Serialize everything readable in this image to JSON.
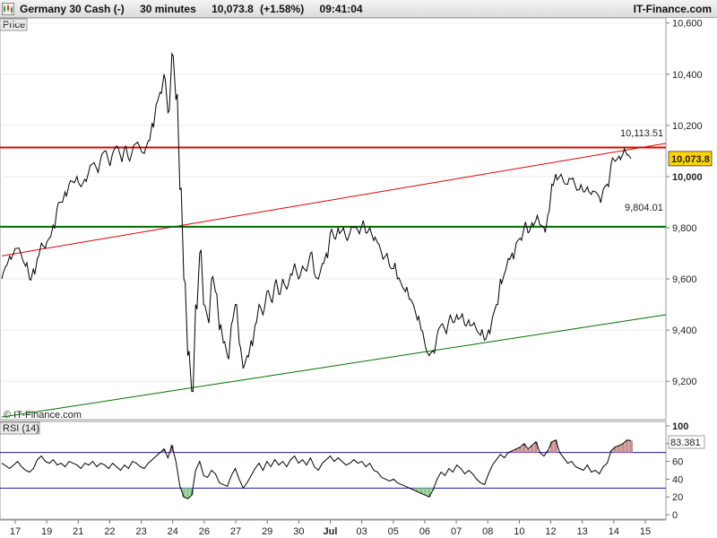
{
  "header": {
    "instrument": "Germany 30 Cash (-)",
    "interval": "30 minutes",
    "price": "10,073.8",
    "change": "(+1.58%)",
    "time": "09:41:04",
    "brand": "IT-Finance.com"
  },
  "price_panel": {
    "label": "Price",
    "copyright": "© IT-Finance.com",
    "last_price": "10,073.8",
    "resistance_label": "10,113.51",
    "support_label": "9,804.01"
  },
  "rsi_panel": {
    "label": "RSI (14)",
    "last_value": "83.381",
    "overbought": 70,
    "oversold": 30
  },
  "colors": {
    "candle": "#000000",
    "resistance": "#e00000",
    "support": "#007000",
    "rsi_line": "#000000",
    "rsi_bounds": "#1a1a9a",
    "rsi_fill_high": "#c89090",
    "rsi_fill_low": "#90c890",
    "price_badge": "#ffd400"
  },
  "chart_data": [
    {
      "type": "line",
      "series_kind": "price",
      "ylim": [
        9050,
        10620
      ],
      "yticks": [
        9200,
        9400,
        9600,
        9800,
        10000,
        10200,
        10400,
        10600
      ],
      "ytick_labels": [
        "9,200",
        "9,400",
        "9,600",
        "9,800",
        "10,000",
        "10,200",
        "10,400",
        "10,600"
      ],
      "xticks": [
        "17",
        "19",
        "21",
        "22",
        "23",
        "24",
        "26",
        "27",
        "29",
        "30",
        "Jul",
        "03",
        "05",
        "06",
        "07",
        "08",
        "10",
        "12",
        "13",
        "14",
        "15"
      ],
      "x": [
        0,
        2,
        4,
        6,
        8,
        10,
        12,
        14,
        16,
        18,
        20,
        22,
        24,
        26,
        28,
        30,
        32,
        34,
        36,
        38,
        40,
        42,
        44,
        46,
        48,
        50,
        52,
        54,
        56,
        58,
        60,
        62,
        64,
        66,
        68,
        70,
        72,
        74,
        76,
        78,
        80,
        82,
        84,
        86,
        88,
        90,
        92,
        94,
        96,
        98,
        100,
        102,
        104,
        106,
        108,
        110,
        112,
        114,
        116,
        118,
        120,
        122,
        124,
        126,
        128,
        130,
        132,
        134,
        136,
        138,
        140,
        142,
        144,
        146,
        148,
        150,
        152,
        154,
        156,
        158,
        160,
        162,
        164,
        166,
        168,
        170,
        172,
        174,
        176,
        178,
        180,
        182,
        184,
        186,
        188,
        190,
        192,
        194,
        196,
        198,
        200,
        202,
        204,
        206,
        208,
        210,
        212,
        214,
        216,
        218,
        220,
        222,
        224,
        226,
        228,
        230,
        232,
        234,
        236,
        238,
        240,
        242,
        244,
        246,
        248,
        250,
        252,
        254,
        256,
        258,
        260,
        262,
        264,
        266,
        268,
        270,
        272,
        274,
        276,
        278,
        280,
        282,
        284,
        286,
        288,
        290,
        292,
        294,
        296,
        298,
        300,
        302,
        304,
        306,
        308,
        310,
        312,
        314,
        316,
        318,
        320,
        322,
        324,
        326,
        328,
        330,
        332,
        334,
        336,
        338,
        340,
        342,
        344,
        346,
        348,
        350
      ],
      "values": [
        9600,
        9650,
        9690,
        9700,
        9720,
        9690,
        9650,
        9600,
        9640,
        9680,
        9740,
        9720,
        9760,
        9810,
        9880,
        9900,
        9940,
        9970,
        9980,
        10000,
        9960,
        9990,
        10020,
        10050,
        10030,
        10070,
        10100,
        10060,
        10090,
        10120,
        10080,
        10110,
        10070,
        10100,
        10130,
        10110,
        10090,
        10140,
        10210,
        10280,
        10330,
        10400,
        10250,
        10480,
        10300,
        9950,
        9600,
        9300,
        9160,
        9500,
        9700,
        9500,
        9450,
        9600,
        9550,
        9400,
        9350,
        9300,
        9420,
        9500,
        9350,
        9250,
        9300,
        9360,
        9420,
        9500,
        9460,
        9550,
        9520,
        9580,
        9540,
        9600,
        9560,
        9620,
        9660,
        9600,
        9650,
        9630,
        9700,
        9620,
        9600,
        9660,
        9700,
        9780,
        9760,
        9800,
        9790,
        9760,
        9780,
        9800,
        9790,
        9810,
        9780,
        9800,
        9750,
        9740,
        9700,
        9690,
        9650,
        9640,
        9600,
        9580,
        9550,
        9520,
        9500,
        9440,
        9400,
        9340,
        9300,
        9320,
        9380,
        9420,
        9400,
        9440,
        9430,
        9460,
        9450,
        9420,
        9440,
        9420,
        9400,
        9380,
        9360,
        9400,
        9450,
        9500,
        9600,
        9620,
        9680,
        9700,
        9740,
        9760,
        9800,
        9780,
        9820,
        9830,
        9810,
        9800,
        9850,
        9970,
        10010,
        10000,
        9980,
        9970,
        9990,
        9960,
        9950,
        9940,
        9960,
        9930,
        9940,
        9920,
        9950,
        9970,
        10050,
        10060,
        10080,
        10090,
        10085,
        10070
      ],
      "horizontal_lines": [
        10113.51,
        9804.01
      ],
      "trendlines": [
        {
          "color": "red",
          "from": [
            0,
            9690
          ],
          "to": [
            365,
            10130
          ]
        },
        {
          "color": "green",
          "from": [
            0,
            9060
          ],
          "to": [
            365,
            9460
          ]
        }
      ]
    },
    {
      "type": "line",
      "series_kind": "rsi",
      "ylim": [
        -5,
        105
      ],
      "yticks": [
        0,
        20,
        40,
        60,
        80,
        100
      ],
      "ytick_labels": [
        "0",
        "20",
        "40",
        "60",
        "80",
        "100"
      ],
      "values": [
        58,
        55,
        52,
        56,
        60,
        54,
        50,
        48,
        52,
        62,
        66,
        60,
        58,
        62,
        56,
        58,
        54,
        60,
        58,
        56,
        52,
        58,
        56,
        60,
        54,
        58,
        56,
        52,
        58,
        54,
        50,
        56,
        52,
        60,
        58,
        54,
        52,
        58,
        62,
        66,
        70,
        74,
        64,
        78,
        60,
        32,
        20,
        18,
        22,
        50,
        60,
        44,
        42,
        50,
        46,
        36,
        34,
        32,
        44,
        52,
        40,
        30,
        36,
        44,
        52,
        58,
        50,
        60,
        54,
        62,
        56,
        60,
        54,
        62,
        66,
        58,
        62,
        56,
        64,
        54,
        50,
        58,
        62,
        66,
        60,
        64,
        60,
        56,
        58,
        62,
        58,
        60,
        54,
        58,
        50,
        48,
        42,
        40,
        38,
        40,
        36,
        34,
        32,
        30,
        28,
        26,
        24,
        22,
        20,
        28,
        40,
        48,
        44,
        52,
        48,
        56,
        52,
        46,
        50,
        46,
        40,
        36,
        34,
        46,
        56,
        62,
        68,
        64,
        70,
        72,
        74,
        76,
        80,
        74,
        78,
        82,
        70,
        66,
        72,
        82,
        84,
        70,
        64,
        58,
        60,
        54,
        52,
        50,
        56,
        48,
        50,
        46,
        54,
        58,
        72,
        76,
        78,
        80,
        84,
        83.381
      ]
    }
  ]
}
